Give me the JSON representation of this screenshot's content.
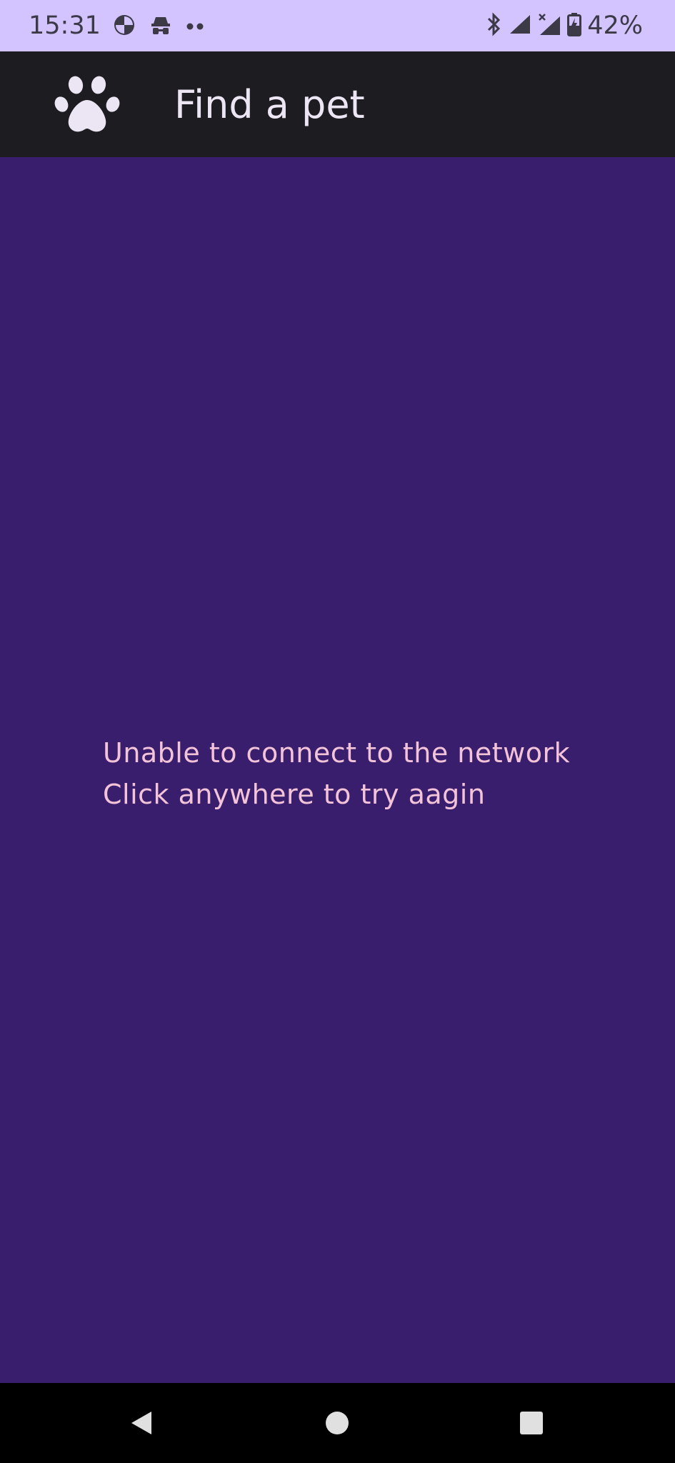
{
  "status_bar": {
    "time": "15:31",
    "battery_text": "42%",
    "left_icons": [
      "data-saver-icon",
      "incognito-icon",
      "more-dots-icon"
    ],
    "right_icons": [
      "bluetooth-icon",
      "signal-icon",
      "signal-no-data-icon",
      "battery-charging-icon"
    ]
  },
  "app_bar": {
    "title": "Find a pet",
    "logo_icon": "paw-icon"
  },
  "content": {
    "error_line_1": "Unable to connect to the network",
    "error_line_2": "Click anywhere to try aagin"
  },
  "nav_bar": {
    "buttons": [
      "back-icon",
      "home-icon",
      "recents-icon"
    ]
  },
  "colors": {
    "status_bar_bg": "#D3C4FF",
    "app_bar_bg": "#1D1C21",
    "content_bg": "#391E6E",
    "error_text": "#F3C3D8",
    "nav_bar_bg": "#000000"
  }
}
